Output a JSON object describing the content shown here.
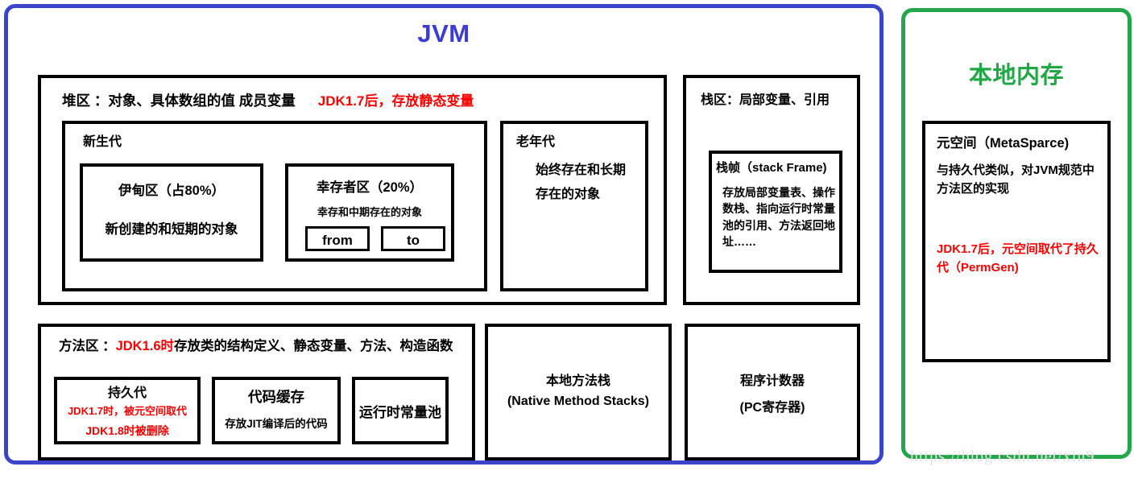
{
  "colors": {
    "jvm_border": "#3b45c8",
    "jvm_title": "#3b3bd8",
    "native_border": "#24a74a",
    "native_title": "#20a845",
    "box_border": "#000000",
    "accent_red": "#fb0000",
    "text": "#000000"
  },
  "jvm": {
    "title": "JVM",
    "heap": {
      "header_black": "堆区 ：对象、具体数组的值 成员变量",
      "header_red": "JDK1.7后，存放静态变量",
      "young": {
        "label": "新生代",
        "eden": {
          "title": "伊甸区（占80%）",
          "subtitle": "新创建的和短期的对象"
        },
        "survivor": {
          "title": "幸存者区（20%）",
          "subtitle": "幸存和中期存在的对象",
          "from_label": "from",
          "to_label": "to"
        }
      },
      "old": {
        "label": "老年代",
        "line1": "始终存在和长期",
        "line2": "存在的对象"
      }
    },
    "stack": {
      "header": "栈区：局部变量、引用",
      "frame": {
        "title": "栈帧（stack Frame)",
        "body": "存放局部变量表、操作数栈、指向运行时常量池的引用、方法返回地址……"
      }
    },
    "method_area": {
      "header_black_1": "方法区 ：",
      "header_red": "JDK1.6时",
      "header_black_2": "存放类的结构定义、静态变量、方法、构造函数",
      "permgen": {
        "title": "持久代",
        "note1": "JDK1.7时，被元空间取代",
        "note2": "JDK1.8时被删除"
      },
      "code_cache": {
        "title": "代码缓存",
        "subtitle": "存放JIT编译后的代码"
      },
      "runtime_constant_pool": {
        "title": "运行时常量池"
      }
    },
    "native_method_stacks": {
      "line1": "本地方法栈",
      "line2": "(Native Method Stacks)"
    },
    "program_counter": {
      "line1": "程序计数器",
      "line2": "(PC寄存器)"
    }
  },
  "native_memory": {
    "title": "本地内存",
    "metaspace": {
      "title": "元空间（MetaSparce)",
      "body": "与持久代类似，对JVM规范中方法区的实现",
      "note": "JDK1.7后，元空间取代了持久代（PermGen)"
    }
  },
  "watermark": "https://blog.csdn.net/xin9"
}
